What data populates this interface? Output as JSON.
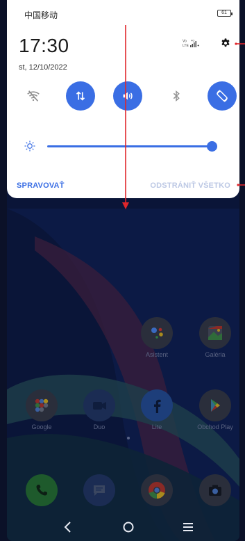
{
  "status_bar": {
    "carrier": "中国移动",
    "battery": "61"
  },
  "clock": {
    "time": "17:30",
    "date": "st, 12/10/2022"
  },
  "signal": {
    "volte_top": "Vo",
    "volte_bottom": "LTE",
    "network": "4G"
  },
  "quick_settings": {
    "wifi": {
      "state": "off"
    },
    "mobile_data": {
      "state": "on"
    },
    "sound": {
      "state": "on"
    },
    "bluetooth": {
      "state": "off"
    },
    "auto_rotate": {
      "state": "on"
    }
  },
  "brightness": {
    "level": 0.95
  },
  "notifications": {
    "manage_label": "SPRAVOVAŤ",
    "clear_all_label": "ODSTRÁNIŤ VŠETKO"
  },
  "home": {
    "apps": [
      {
        "label": "Asistent",
        "icon": "assistant-icon"
      },
      {
        "label": "Galéria",
        "icon": "gallery-icon"
      },
      {
        "label": "Google",
        "icon": "google-folder-icon"
      },
      {
        "label": "Duo",
        "icon": "duo-icon"
      },
      {
        "label": "Lite",
        "icon": "facebook-lite-icon"
      },
      {
        "label": "Obchod Play",
        "icon": "play-store-icon"
      }
    ],
    "dock": [
      {
        "icon": "phone-icon"
      },
      {
        "icon": "messages-icon"
      },
      {
        "icon": "chrome-icon"
      },
      {
        "icon": "camera-icon"
      }
    ]
  },
  "colors": {
    "accent": "#3a6ee4",
    "annotation": "#e0262b"
  }
}
